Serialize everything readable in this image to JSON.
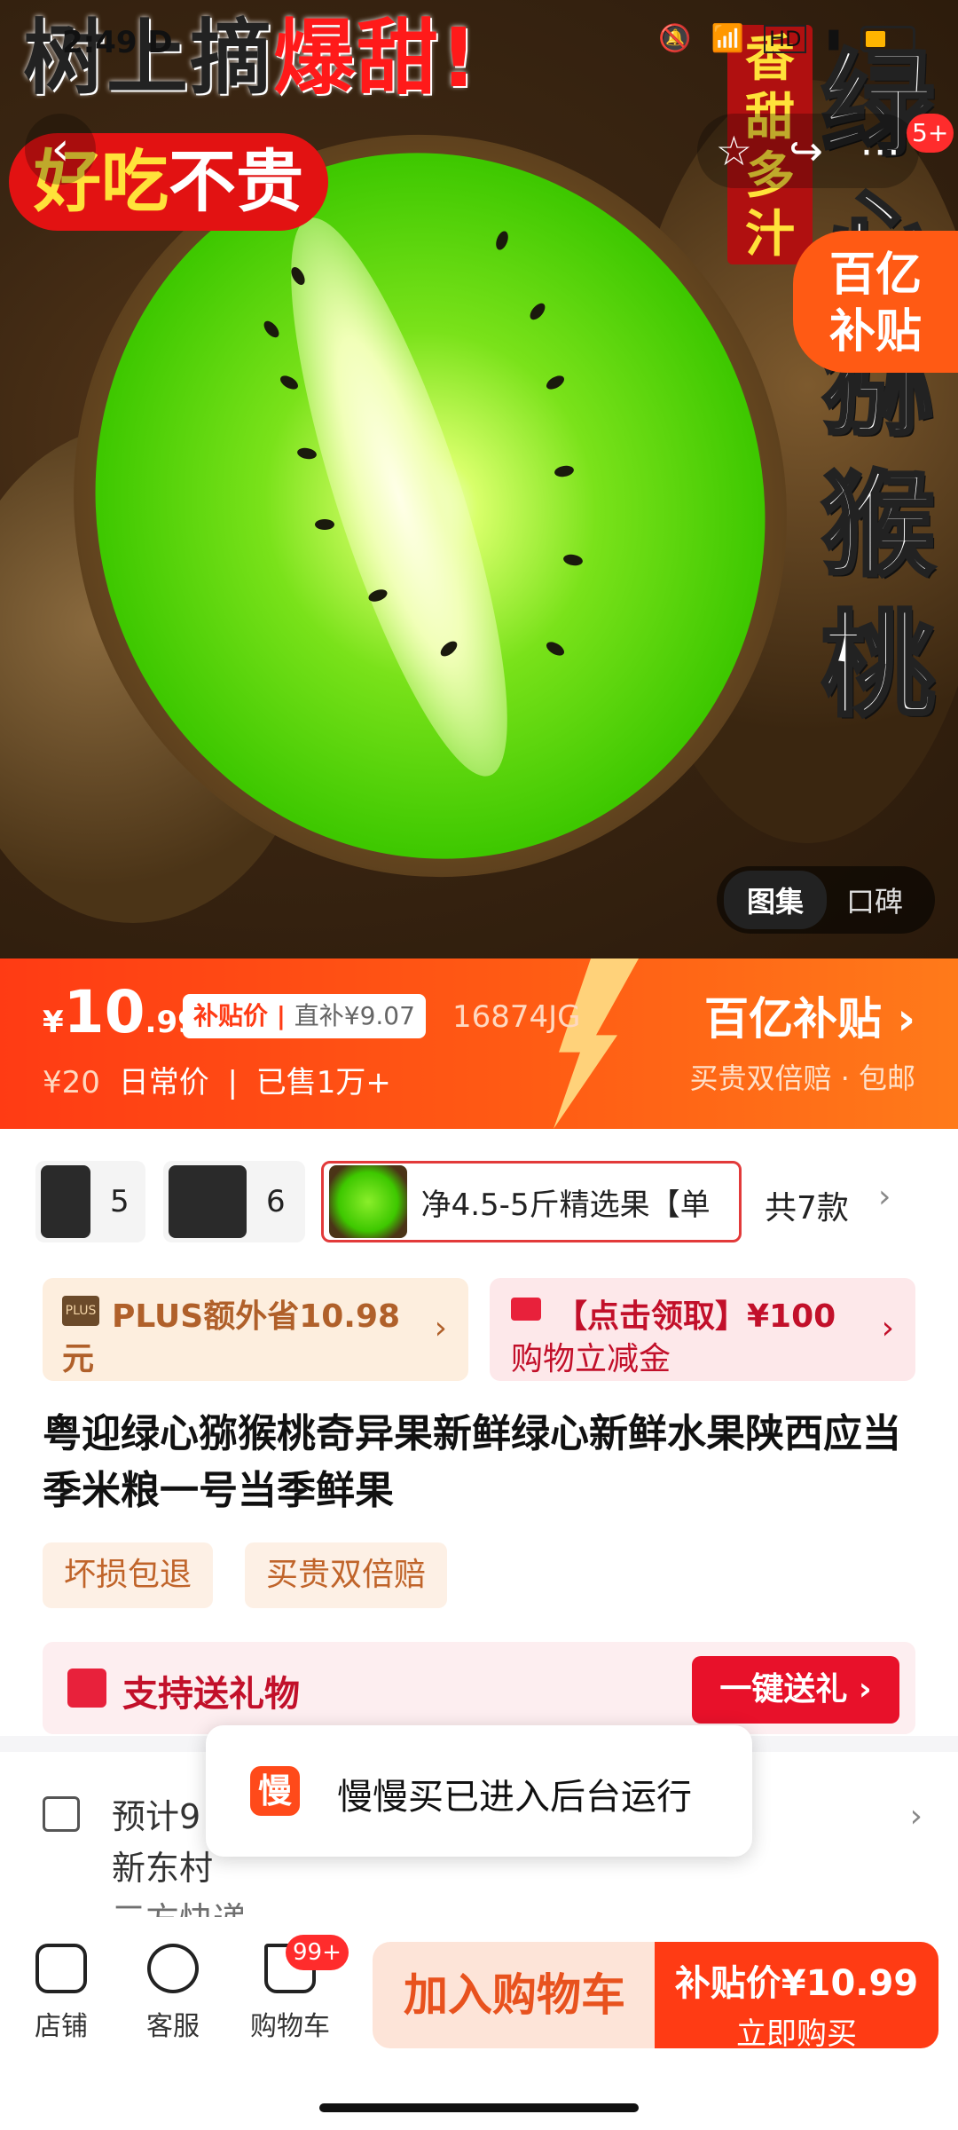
{
  "status_bar": {
    "time": "2:49",
    "extra": "D",
    "battery_pct": "59"
  },
  "hero": {
    "promo_line1_dark": "树上摘",
    "promo_line1_red": "爆甜!",
    "promo_line2_yellow": "好吃",
    "promo_line2_white": "不贵",
    "vertical_red": "香甜多汁",
    "vertical_big": "绿心猕猴桃",
    "subsidy_badge_line1": "百亿",
    "subsidy_badge_line2": "补贴",
    "nav_badge": "5+",
    "gallery_active": "图集",
    "gallery_inactive": "口碑"
  },
  "price": {
    "currency": "¥",
    "int": "10",
    "dec": ".99",
    "tag_label": "补贴价",
    "tag_after": "直补¥9.07",
    "code": "16874JG",
    "original": "¥20",
    "original_label": "日常价",
    "sold": "已售1万+",
    "brand_title": "百亿补贴 ›",
    "brand_sub": "买贵双倍赔 · 包邮"
  },
  "sku": {
    "items": [
      {
        "n": "5"
      },
      {
        "n": "6"
      }
    ],
    "selected_text": "净4.5-5斤精选果【单",
    "total": "共7款",
    "arrow": "›"
  },
  "plus_card": {
    "badge": "PLUS",
    "line1": "PLUS额外省10.98",
    "line2": "元",
    "arrow": "›"
  },
  "coupon_card": {
    "line1": "【点击领取】¥100",
    "line2": "购物立减金",
    "arrow": "›"
  },
  "title": "粤迎绿心猕猴桃奇异果新鲜绿心新鲜水果陕西应当季米粮一号当季鲜果",
  "features": [
    "坏损包退",
    "买贵双倍赔"
  ],
  "gift": {
    "label": "支持送礼物",
    "button": "一键送礼 ›"
  },
  "delivery": {
    "line1": "预计9",
    "line2": "新东村",
    "line3": "三方快递",
    "arrow": "›"
  },
  "toast": {
    "logo": "慢",
    "text": "慢慢买已进入后台运行"
  },
  "bottom": {
    "store": "店铺",
    "service": "客服",
    "cart": "购物车",
    "cart_badge": "99+",
    "add_cart": "加入购物车",
    "buy_price": "补贴价¥10.99",
    "buy_now": "立即购买"
  }
}
